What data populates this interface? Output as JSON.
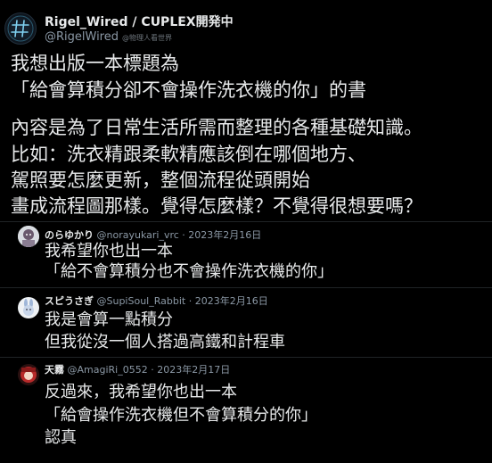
{
  "author": {
    "display_name": "Rigel_Wired / CUPLEX開発中",
    "handle": "@RigelWired",
    "handle_note": "@物理人看世界"
  },
  "post": {
    "lines": [
      "我想出版一本標題為",
      "「給會算積分卻不會操作洗衣機的你」的書",
      "內容是為了日常生活所需而整理的各種基礎知識。",
      "比如：洗衣精跟柔軟精應該倒在哪個地方、",
      "駕照要怎麼更新，整個流程從頭開始",
      "畫成流程圖那樣。覺得怎麼樣？不覺得很想要嗎？"
    ]
  },
  "replies": [
    {
      "name": "のらゆかり",
      "handle": "@norayukari_vrc",
      "date": "2023年2月16日",
      "lines": [
        "我希望你也出一本",
        "「給不會算積分也不會操作洗衣機的你」"
      ]
    },
    {
      "name": "スピうさぎ",
      "handle": "@SupiSoul_Rabbit",
      "date": "2023年2月16日",
      "lines": [
        "我是會算一點積分",
        "但我從沒一個人搭過高鐵和計程車"
      ]
    },
    {
      "name": "天霧",
      "handle": "@AmagiRi_0552",
      "date": "2023年2月17日",
      "lines": [
        "反過來，我希望你也出一本",
        "「給會操作洗衣機但不會算積分的你」",
        "認真"
      ]
    }
  ],
  "separator": "·"
}
